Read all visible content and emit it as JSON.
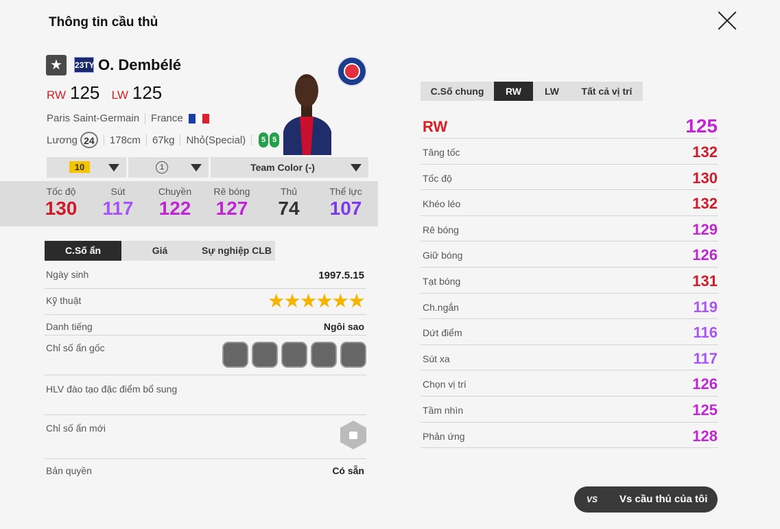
{
  "header": {
    "title": "Thông tin cầu thủ"
  },
  "player": {
    "season_badge": "23TY",
    "name": "O. Dembélé",
    "positions": [
      {
        "pos": "RW",
        "ovr": "125"
      },
      {
        "pos": "LW",
        "ovr": "125"
      }
    ],
    "club": "Paris Saint-Germain",
    "nation": "France",
    "salary_label": "Lương",
    "salary": "24",
    "height": "178cm",
    "weight": "67kg",
    "body_type": "Nhỏ(Special)",
    "weak_foot_left": "5",
    "weak_foot_right": "5"
  },
  "controls": {
    "upgrade_level": "10",
    "chemistry": "1",
    "team_color": "Team Color (-)"
  },
  "main_stats": [
    {
      "label": "Tốc độ",
      "value": "130",
      "color": "#d11a2a"
    },
    {
      "label": "Sút",
      "value": "117",
      "color": "#a855f7"
    },
    {
      "label": "Chuyền",
      "value": "122",
      "color": "#c026d3"
    },
    {
      "label": "Rê bóng",
      "value": "127",
      "color": "#c026d3"
    },
    {
      "label": "Thủ",
      "value": "74",
      "color": "#333333"
    },
    {
      "label": "Thể lực",
      "value": "107",
      "color": "#7c3aed"
    }
  ],
  "left_tabs": [
    "C.Số ẩn",
    "Giá",
    "Sự nghiệp CLB"
  ],
  "hidden": {
    "birth_label": "Ngày sinh",
    "birth": "1997.5.15",
    "skill_label": "Kỹ thuật",
    "skill_stars": 6,
    "rep_label": "Danh tiếng",
    "rep": "Ngôi sao",
    "traits_label": "Chỉ số ẩn gốc",
    "traits": [
      "trait-icon-1",
      "trait-icon-2",
      "trait-icon-3",
      "trait-icon-4",
      "trait-icon-5"
    ],
    "coach_label": "HLV đào tạo đặc điểm bổ sung",
    "new_label": "Chỉ số ẩn mới",
    "license_label": "Bản quyền",
    "license": "Có sẵn"
  },
  "right_tabs": [
    "C.Số chung",
    "RW",
    "LW",
    "Tất cả vị trí"
  ],
  "detail": {
    "pos": "RW",
    "pos_value": "125",
    "rows": [
      {
        "label": "Tăng tốc",
        "value": "132",
        "color": "#d11a2a"
      },
      {
        "label": "Tốc độ",
        "value": "130",
        "color": "#d11a2a"
      },
      {
        "label": "Khéo léo",
        "value": "132",
        "color": "#d11a2a"
      },
      {
        "label": "Rê bóng",
        "value": "129",
        "color": "#c026d3"
      },
      {
        "label": "Giữ bóng",
        "value": "126",
        "color": "#c026d3"
      },
      {
        "label": "Tạt bóng",
        "value": "131",
        "color": "#d11a2a"
      },
      {
        "label": "Ch.ngắn",
        "value": "119",
        "color": "#a855f7"
      },
      {
        "label": "Dứt điểm",
        "value": "116",
        "color": "#a855f7"
      },
      {
        "label": "Sút xa",
        "value": "117",
        "color": "#a855f7"
      },
      {
        "label": "Chọn vị trí",
        "value": "126",
        "color": "#c026d3"
      },
      {
        "label": "Tầm nhìn",
        "value": "125",
        "color": "#c026d3"
      },
      {
        "label": "Phản ứng",
        "value": "128",
        "color": "#c026d3"
      }
    ]
  },
  "compare_button": {
    "icon": "VS",
    "label": "Vs cầu thủ của tôi"
  }
}
